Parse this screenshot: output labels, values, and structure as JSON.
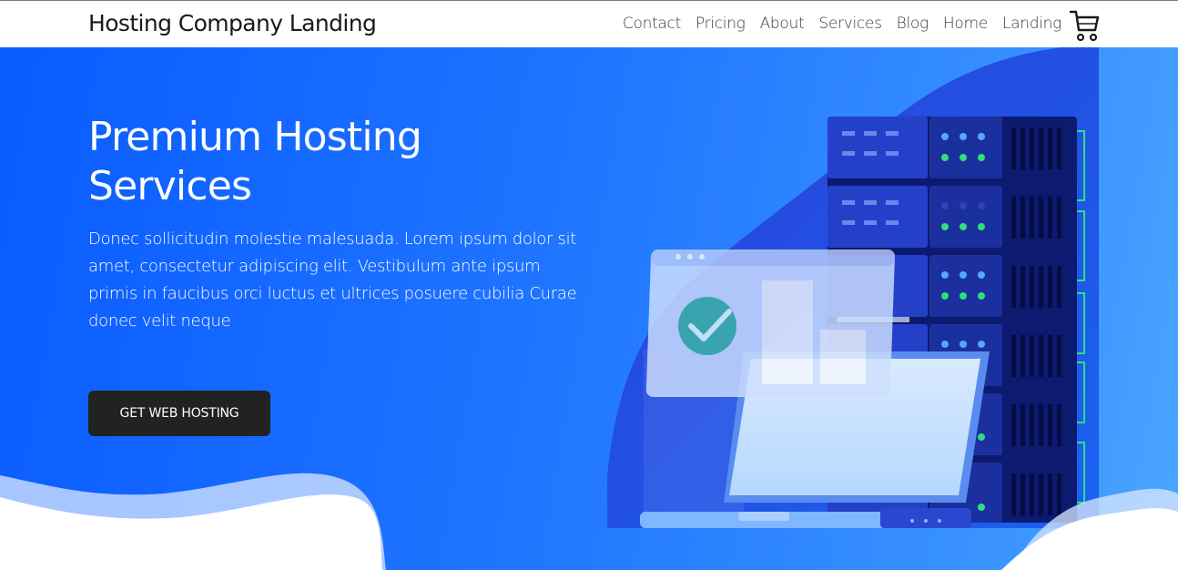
{
  "navbar": {
    "brand": "Hosting Company Landing",
    "links": [
      "Contact",
      "Pricing",
      "About",
      "Services",
      "Blog",
      "Home",
      "Landing"
    ],
    "cart_icon": "cart-icon"
  },
  "hero": {
    "title": "Premium Hosting Services",
    "description": "Donec sollicitudin molestie malesuada. Lorem ipsum dolor sit amet, consectetur adipiscing elit. Vestibulum ante ipsum primis in faucibus orci luctus et ultrices posuere cubilia Curae donec velit neque",
    "cta_label": "GET WEB HOSTING",
    "illustration": "server-laptop-illustration"
  },
  "colors": {
    "hero_start": "#0a5bff",
    "hero_end": "#4aa6ff",
    "cta_bg": "#222222",
    "nav_text": "#3a3a3a"
  }
}
